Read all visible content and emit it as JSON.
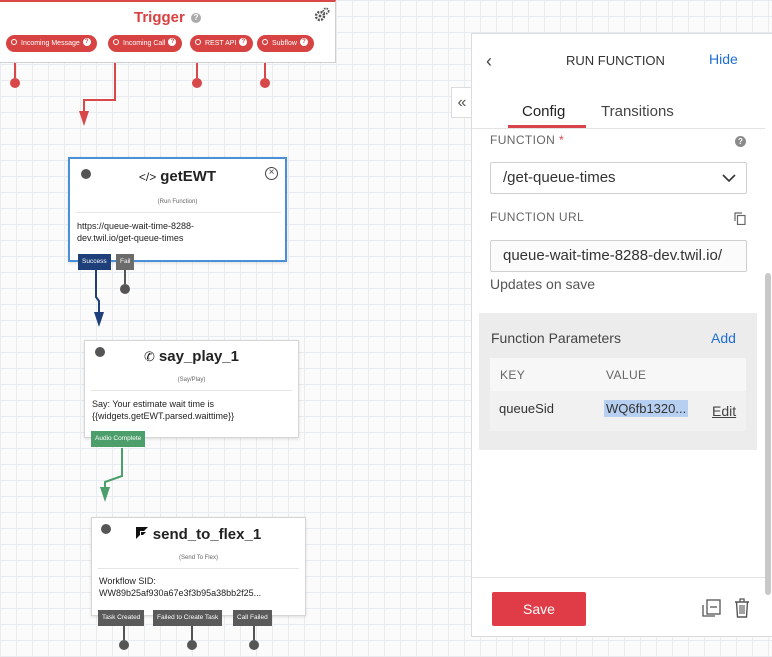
{
  "trigger": {
    "title": "Trigger",
    "help_glyph": "?",
    "pills": [
      "Incoming Message",
      "Incoming Call",
      "REST API",
      "Subflow"
    ]
  },
  "widgets": {
    "get_ewt": {
      "title": "getEWT",
      "type": "(Run Function)",
      "body": "https://queue-wait-time-8288-dev.twil.io/get-queue-times",
      "transitions": [
        "Success",
        "Fail"
      ]
    },
    "say_play": {
      "title": "say_play_1",
      "type": "(Say/Play)",
      "body": "Say: Your estimate wait time is {{widgets.getEWT.parsed.waittime}}",
      "transitions": [
        "Audio Complete"
      ]
    },
    "send_to_flex": {
      "title": "send_to_flex_1",
      "type": "(Send To Flex)",
      "body": "Workflow SID: WW89b25af930a67e3f3b95a38bb2f25...",
      "transitions": [
        "Task Created",
        "Failed to Create Task",
        "Call Failed"
      ]
    }
  },
  "panel": {
    "title": "RUN FUNCTION",
    "hide_label": "Hide",
    "tabs": [
      "Config",
      "Transitions"
    ],
    "active_tab": "Config",
    "function_label": "FUNCTION",
    "required_mark": "*",
    "function_value": "/get-queue-times",
    "function_url_label": "FUNCTION URL",
    "function_url_value": "queue-wait-time-8288-dev.twil.io/",
    "updates_note": "Updates on save",
    "params": {
      "title": "Function Parameters",
      "add_label": "Add",
      "col_key": "KEY",
      "col_value": "VALUE",
      "rows": [
        {
          "key": "queueSid",
          "value": "WQ6fb1320...",
          "edit": "Edit"
        }
      ]
    },
    "save_label": "Save"
  },
  "colors": {
    "trigger_red": "#d74343",
    "selected_blue": "#4a90d9",
    "success_navy": "#1e3f7a",
    "audio_green": "#4c9e6a",
    "link_blue": "#1f6fd0",
    "save_red": "#e03c47"
  }
}
